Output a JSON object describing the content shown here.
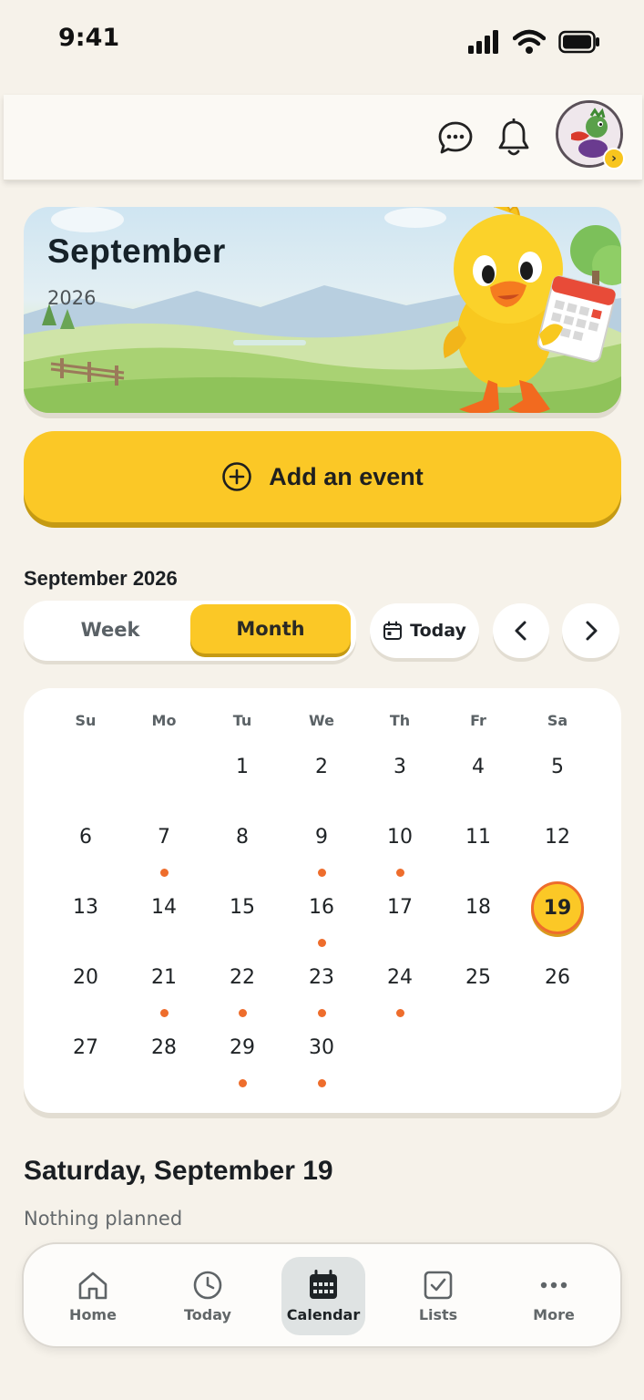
{
  "status_bar": {
    "time": "9:41"
  },
  "top_bar": {
    "icons": [
      "chat-bubble-icon",
      "bell-icon",
      "avatar-chevron-icon"
    ]
  },
  "hero": {
    "month": "September",
    "year": "2026"
  },
  "add_event": {
    "label": "Add an event"
  },
  "calendar_header": {
    "title": "September 2026",
    "week_label": "Week",
    "month_label": "Month",
    "today_label": "Today",
    "active_view": "Month"
  },
  "calendar": {
    "weekdays": [
      "Su",
      "Mo",
      "Tu",
      "We",
      "Th",
      "Fr",
      "Sa"
    ],
    "weeks": [
      [
        "",
        "",
        "1",
        "2",
        "3",
        "4",
        "5"
      ],
      [
        "6",
        "7",
        "8",
        "9",
        "10",
        "11",
        "12"
      ],
      [
        "13",
        "14",
        "15",
        "16",
        "17",
        "18",
        "19"
      ],
      [
        "20",
        "21",
        "22",
        "23",
        "24",
        "25",
        "26"
      ],
      [
        "27",
        "28",
        "29",
        "30",
        "",
        "",
        ""
      ]
    ],
    "days_with_events": [
      7,
      9,
      10,
      16,
      21,
      22,
      23,
      24,
      29,
      30
    ],
    "selected_day": 19,
    "colors": {
      "accent": "#fbc826",
      "event_dot": "#ee6d2c"
    }
  },
  "selected_day_panel": {
    "title": "Saturday, September 19",
    "empty_text": "Nothing planned"
  },
  "tabbar": {
    "items": [
      {
        "label": "Home",
        "icon": "home-icon"
      },
      {
        "label": "Today",
        "icon": "clock-icon"
      },
      {
        "label": "Calendar",
        "icon": "calendar-icon"
      },
      {
        "label": "Lists",
        "icon": "checkbox-icon"
      },
      {
        "label": "More",
        "icon": "more-dots-icon"
      }
    ],
    "active": "Calendar"
  }
}
